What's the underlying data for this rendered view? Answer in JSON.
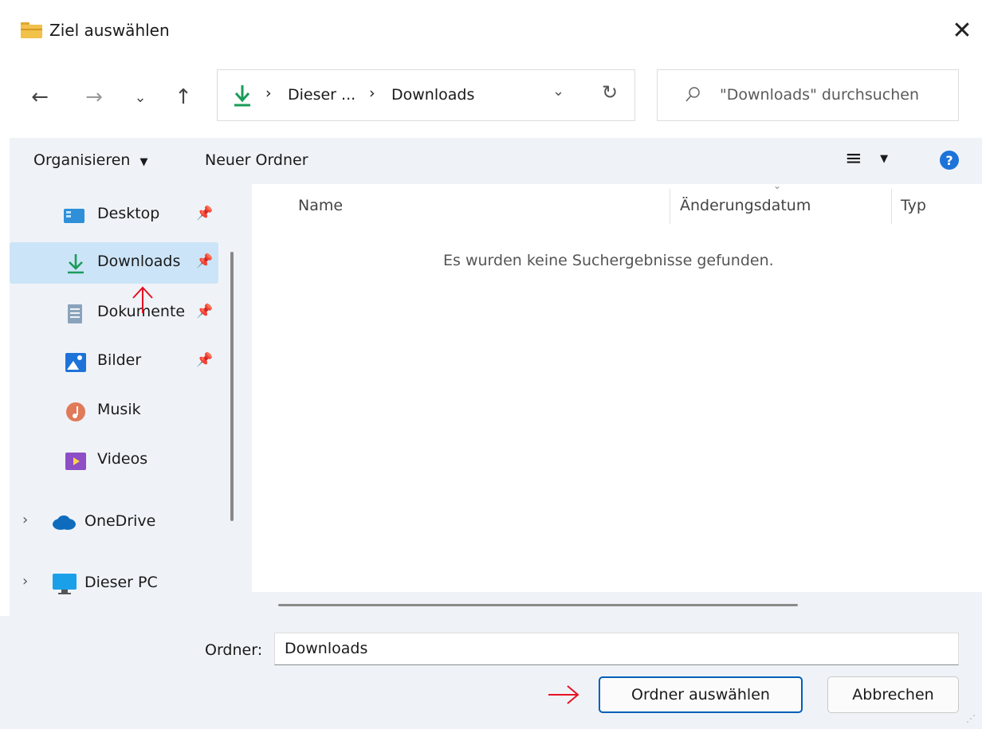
{
  "window": {
    "title": "Ziel auswählen",
    "close_glyph": "✕"
  },
  "nav": {
    "back_glyph": "←",
    "forward_glyph": "→",
    "recent_glyph": "⌄",
    "up_glyph": "↑"
  },
  "address": {
    "sep1": "›",
    "crumb1": "Dieser ...",
    "sep2": "›",
    "crumb2": "Downloads",
    "dropdown_glyph": "⌄",
    "refresh_glyph": "↻"
  },
  "search": {
    "placeholder": "\"Downloads\" durchsuchen"
  },
  "commandbar": {
    "organize_label": "Organisieren",
    "new_folder_label": "Neuer Ordner",
    "view_glyph": "≡",
    "help_glyph": "?"
  },
  "sidebar": {
    "items": [
      {
        "label": "Desktop",
        "icon": "desktop-icon",
        "pinned": true
      },
      {
        "label": "Downloads",
        "icon": "downloads-icon",
        "pinned": true,
        "selected": true
      },
      {
        "label": "Dokumente",
        "icon": "documents-icon",
        "pinned": true
      },
      {
        "label": "Bilder",
        "icon": "pictures-icon",
        "pinned": true
      },
      {
        "label": "Musik",
        "icon": "music-icon",
        "pinned": false
      },
      {
        "label": "Videos",
        "icon": "videos-icon",
        "pinned": false
      }
    ],
    "groups": [
      {
        "label": "OneDrive",
        "icon": "onedrive-icon"
      },
      {
        "label": "Dieser PC",
        "icon": "this-pc-icon"
      }
    ]
  },
  "filelist": {
    "columns": [
      "Name",
      "Änderungsdatum",
      "Typ"
    ],
    "empty_message": "Es wurden keine Suchergebnisse gefunden."
  },
  "footer": {
    "folder_label": "Ordner:",
    "folder_value": "Downloads",
    "select_button": "Ordner auswählen",
    "cancel_button": "Abbrechen"
  },
  "colors": {
    "accent": "#005fb8",
    "selection": "#cce4f7",
    "pane_bg": "#eff3f8",
    "annotation_red": "#e81123",
    "download_green": "#1a9c5a"
  }
}
